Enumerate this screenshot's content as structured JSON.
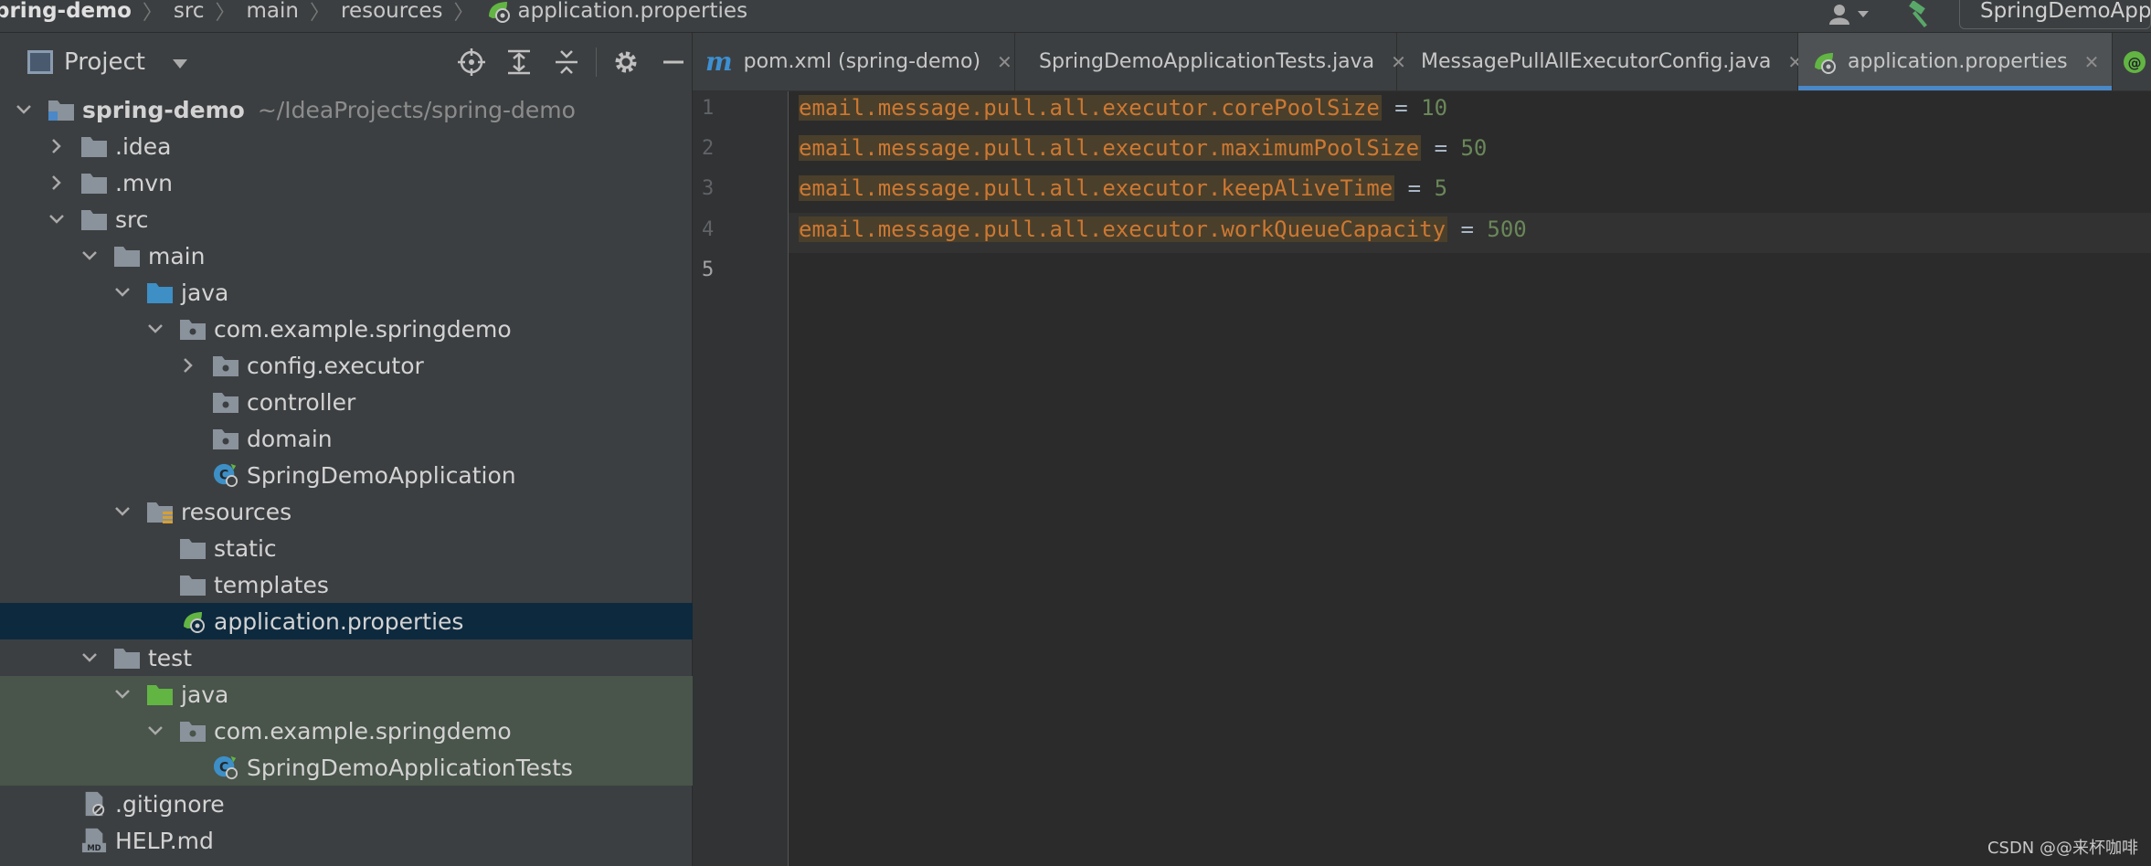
{
  "breadcrumb": [
    "pring-demo",
    "src",
    "main",
    "resources",
    "application.properties"
  ],
  "run_config": "SpringDemoAppli",
  "project_panel": {
    "title": "Project"
  },
  "tree": [
    {
      "label": "spring-demo",
      "hint": "~/IdeaProjects/spring-demo",
      "icon": "module-folder-icon",
      "expanded": true
    },
    {
      "label": ".idea",
      "icon": "folder-icon",
      "expanded": false
    },
    {
      "label": ".mvn",
      "icon": "folder-icon",
      "expanded": false
    },
    {
      "label": "src",
      "icon": "folder-icon",
      "expanded": true
    },
    {
      "label": "main",
      "icon": "folder-icon",
      "expanded": true
    },
    {
      "label": "java",
      "icon": "source-folder-icon",
      "expanded": true
    },
    {
      "label": "com.example.springdemo",
      "icon": "package-icon",
      "expanded": true
    },
    {
      "label": "config.executor",
      "icon": "package-icon",
      "expanded": false
    },
    {
      "label": "controller",
      "icon": "package-icon"
    },
    {
      "label": "domain",
      "icon": "package-icon"
    },
    {
      "label": "SpringDemoApplication",
      "icon": "spring-class-icon"
    },
    {
      "label": "resources",
      "icon": "resources-folder-icon",
      "expanded": true
    },
    {
      "label": "static",
      "icon": "folder-icon"
    },
    {
      "label": "templates",
      "icon": "folder-icon"
    },
    {
      "label": "application.properties",
      "icon": "spring-properties-icon",
      "selected": true
    },
    {
      "label": "test",
      "icon": "folder-icon",
      "expanded": true
    },
    {
      "label": "java",
      "icon": "test-source-folder-icon",
      "expanded": true
    },
    {
      "label": "com.example.springdemo",
      "icon": "package-icon",
      "expanded": true
    },
    {
      "label": "SpringDemoApplicationTests",
      "icon": "spring-class-icon"
    },
    {
      "label": ".gitignore",
      "icon": "gitignore-file-icon"
    },
    {
      "label": "HELP.md",
      "icon": "markdown-file-icon"
    }
  ],
  "tabs": [
    {
      "label": "pom.xml (spring-demo)",
      "icon": "maven-icon"
    },
    {
      "label": "SpringDemoApplicationTests.java",
      "icon": "spring-class-icon"
    },
    {
      "label": "MessagePullAllExecutorConfig.java",
      "icon": "class-icon"
    },
    {
      "label": "application.properties",
      "icon": "spring-properties-icon",
      "active": true
    }
  ],
  "editor": {
    "line_numbers": [
      "1",
      "2",
      "3",
      "4",
      "5"
    ],
    "lines": [
      {
        "key": "email.message.pull.all.executor.corePoolSize",
        "eq": " = ",
        "value": "10"
      },
      {
        "key": "email.message.pull.all.executor.maximumPoolSize",
        "eq": " = ",
        "value": "50"
      },
      {
        "key": "email.message.pull.all.executor.keepAliveTime",
        "eq": " = ",
        "value": "5"
      },
      {
        "key": "email.message.pull.all.executor.workQueueCapacity",
        "eq": " = ",
        "value": "500"
      }
    ]
  },
  "watermark": "CSDN @@来杯咖啡",
  "colors": {
    "selection": "#0d293e",
    "key": "#cc7832",
    "value": "#6a8759",
    "tab_underline": "#4a88c7",
    "test_bg": "#49544a"
  }
}
